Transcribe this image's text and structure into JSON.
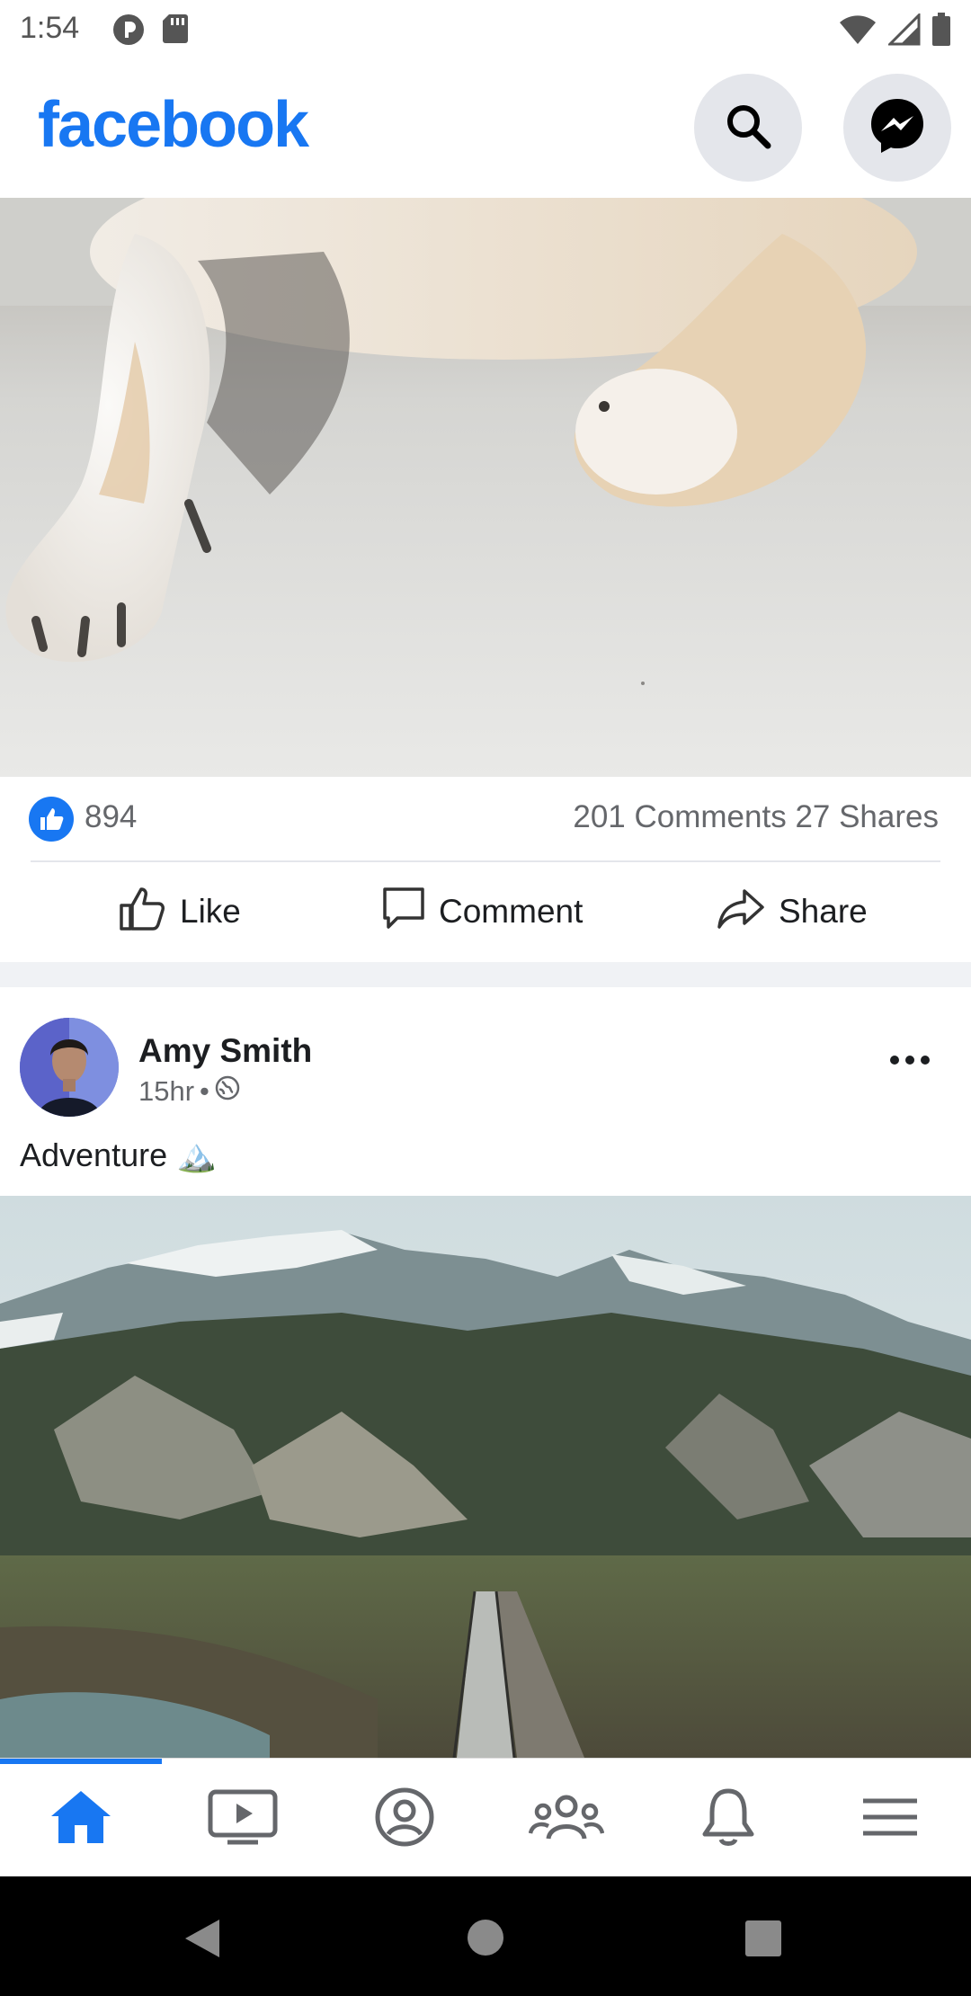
{
  "status_bar": {
    "time": "1:54",
    "left_icons": [
      "pocket-casts-icon",
      "sd-card-icon"
    ],
    "right_icons": [
      "wifi-icon",
      "signal-icon",
      "battery-icon"
    ]
  },
  "app_bar": {
    "logo": "facebook",
    "brand_color": "#1877f2",
    "buttons": [
      "search-icon",
      "messenger-icon"
    ]
  },
  "post1": {
    "image_icon": "dog-paws-photo",
    "like_count": "894",
    "comments": "201 Comments",
    "shares": "27 Shares",
    "actions": {
      "like": "Like",
      "comment": "Comment",
      "share": "Share"
    }
  },
  "post2": {
    "author": "Amy Smith",
    "time": "15hr",
    "separator": "•",
    "privacy_icon": "globe-icon",
    "text": "Adventure 🏔️",
    "image_icon": "mountain-landscape-photo"
  },
  "bottom_nav": {
    "items": [
      "home-icon",
      "watch-icon",
      "profile-icon",
      "groups-icon",
      "notifications-icon",
      "menu-icon"
    ],
    "active_index": 0
  },
  "system_nav": [
    "back-icon",
    "home-circle-icon",
    "recents-icon"
  ]
}
